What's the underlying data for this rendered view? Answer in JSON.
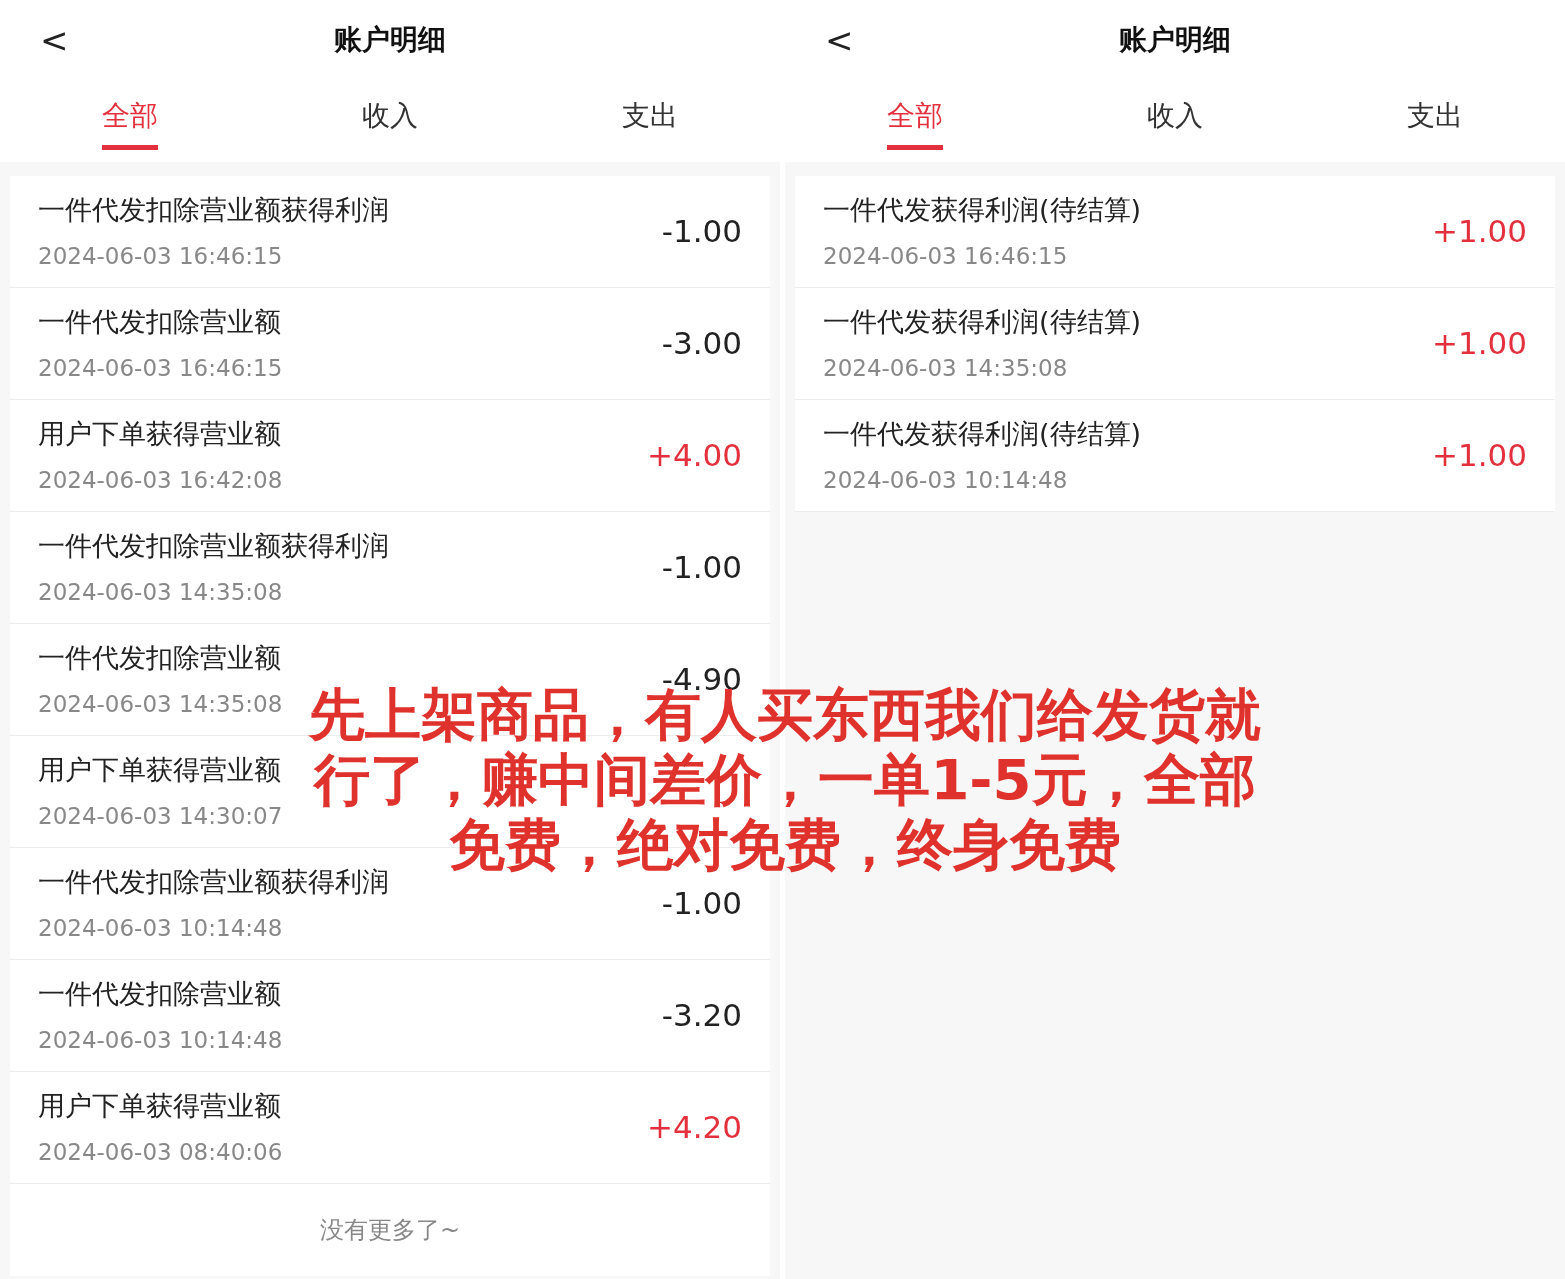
{
  "panels": [
    {
      "title": "账户明细",
      "back": "<",
      "tabs": [
        {
          "label": "全部",
          "selected": true
        },
        {
          "label": "收入",
          "selected": false
        },
        {
          "label": "支出",
          "selected": false
        }
      ],
      "rows": [
        {
          "name": "一件代发扣除营业额获得利润",
          "time": "2024-06-03 16:46:15",
          "amount": "-1.00",
          "kind": "expense"
        },
        {
          "name": "一件代发扣除营业额",
          "time": "2024-06-03 16:46:15",
          "amount": "-3.00",
          "kind": "expense"
        },
        {
          "name": "用户下单获得营业额",
          "time": "2024-06-03 16:42:08",
          "amount": "+4.00",
          "kind": "income"
        },
        {
          "name": "一件代发扣除营业额获得利润",
          "time": "2024-06-03 14:35:08",
          "amount": "-1.00",
          "kind": "expense"
        },
        {
          "name": "一件代发扣除营业额",
          "time": "2024-06-03 14:35:08",
          "amount": "-4.90",
          "kind": "expense"
        },
        {
          "name": "用户下单获得营业额",
          "time": "2024-06-03 14:30:07",
          "kind": "income"
        },
        {
          "name": "一件代发扣除营业额获得利润",
          "time": "2024-06-03 10:14:48",
          "amount": "-1.00",
          "kind": "expense"
        },
        {
          "name": "一件代发扣除营业额",
          "time": "2024-06-03 10:14:48",
          "amount": "-3.20",
          "kind": "expense"
        },
        {
          "name": "用户下单获得营业额",
          "time": "2024-06-03 08:40:06",
          "amount": "+4.20",
          "kind": "income"
        }
      ],
      "footer": "没有更多了~"
    },
    {
      "title": "账户明细",
      "back": "<",
      "tabs": [
        {
          "label": "全部",
          "selected": true
        },
        {
          "label": "收入",
          "selected": false
        },
        {
          "label": "支出",
          "selected": false
        }
      ],
      "rows": [
        {
          "name": "一件代发获得利润(待结算)",
          "time": "2024-06-03 16:46:15",
          "amount": "+1.00",
          "kind": "income"
        },
        {
          "name": "一件代发获得利润(待结算)",
          "time": "2024-06-03 14:35:08",
          "amount": "+1.00",
          "kind": "income"
        },
        {
          "name": "一件代发获得利润(待结算)",
          "time": "2024-06-03 10:14:48",
          "amount": "+1.00",
          "kind": "income"
        }
      ]
    }
  ],
  "caption": [
    "先上架商品，有人买东西我们给发货就",
    "行了，赚中间差价，一单1-5元，全部",
    "免费，绝对免费，终身免费"
  ]
}
